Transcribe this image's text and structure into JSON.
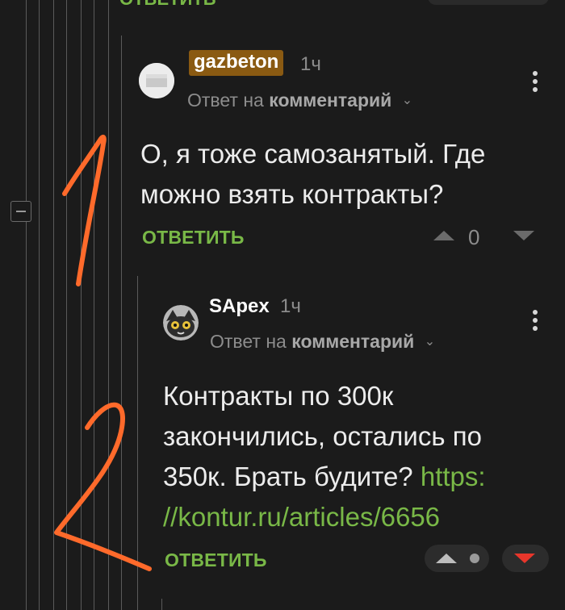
{
  "top_partial": {
    "reply_label": "ОТВЕТИТЬ"
  },
  "comment1": {
    "username": "gazbeton",
    "time": "1ч",
    "reply_to_prefix": "Ответ на",
    "reply_to_target": "комментарий",
    "text": "О, я тоже самозанятый. Где можно взять контракты?",
    "reply_label": "ОТВЕТИТЬ",
    "score": "0"
  },
  "comment2": {
    "username": "SApex",
    "time": "1ч",
    "reply_to_prefix": "Ответ на",
    "reply_to_target": "комментарий",
    "text_lines": [
      "Контракты по 300к",
      "закончились, остались по",
      "350к. Брать будите? "
    ],
    "link_line1": "https:",
    "link_line2": "//kontur.ru/articles/6656",
    "reply_label": "ОТВЕТИТЬ"
  },
  "colors": {
    "background": "#1b1b1b",
    "accent_green": "#79b847",
    "highlight_username": "#8a5a12",
    "downvote_active": "#e8362b",
    "annotation_orange": "#ff6a2b"
  },
  "icons": [
    "kebab-menu-icon",
    "chevron-down-icon",
    "upvote-icon",
    "downvote-icon",
    "collapse-icon"
  ]
}
